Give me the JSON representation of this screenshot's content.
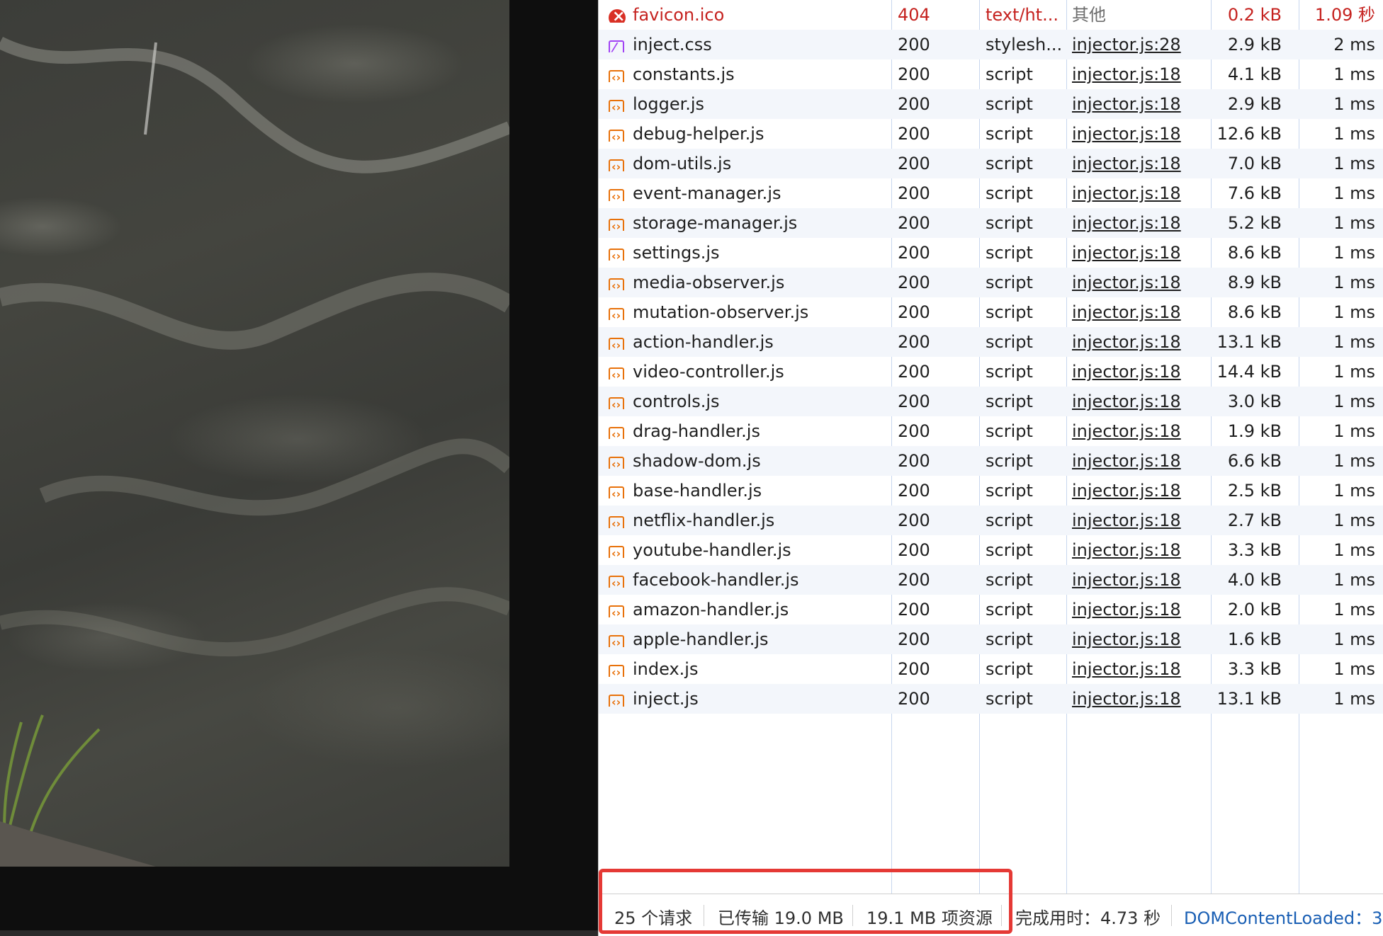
{
  "requests": [
    {
      "name": "favicon.ico",
      "status": "404",
      "type": "text/ht...",
      "initiator": "其他",
      "size": "0.2 kB",
      "time": "1.09 秒",
      "icon": "error-icon",
      "error": true
    },
    {
      "name": "inject.css",
      "status": "200",
      "type": "stylesh...",
      "initiator": "injector.js:28",
      "size": "2.9 kB",
      "time": "2 ms",
      "icon": "stylesheet-icon"
    },
    {
      "name": "constants.js",
      "status": "200",
      "type": "script",
      "initiator": "injector.js:18",
      "size": "4.1 kB",
      "time": "1 ms",
      "icon": "script-icon"
    },
    {
      "name": "logger.js",
      "status": "200",
      "type": "script",
      "initiator": "injector.js:18",
      "size": "2.9 kB",
      "time": "1 ms",
      "icon": "script-icon"
    },
    {
      "name": "debug-helper.js",
      "status": "200",
      "type": "script",
      "initiator": "injector.js:18",
      "size": "12.6 kB",
      "time": "1 ms",
      "icon": "script-icon"
    },
    {
      "name": "dom-utils.js",
      "status": "200",
      "type": "script",
      "initiator": "injector.js:18",
      "size": "7.0 kB",
      "time": "1 ms",
      "icon": "script-icon"
    },
    {
      "name": "event-manager.js",
      "status": "200",
      "type": "script",
      "initiator": "injector.js:18",
      "size": "7.6 kB",
      "time": "1 ms",
      "icon": "script-icon"
    },
    {
      "name": "storage-manager.js",
      "status": "200",
      "type": "script",
      "initiator": "injector.js:18",
      "size": "5.2 kB",
      "time": "1 ms",
      "icon": "script-icon"
    },
    {
      "name": "settings.js",
      "status": "200",
      "type": "script",
      "initiator": "injector.js:18",
      "size": "8.6 kB",
      "time": "1 ms",
      "icon": "script-icon"
    },
    {
      "name": "media-observer.js",
      "status": "200",
      "type": "script",
      "initiator": "injector.js:18",
      "size": "8.9 kB",
      "time": "1 ms",
      "icon": "script-icon"
    },
    {
      "name": "mutation-observer.js",
      "status": "200",
      "type": "script",
      "initiator": "injector.js:18",
      "size": "8.6 kB",
      "time": "1 ms",
      "icon": "script-icon"
    },
    {
      "name": "action-handler.js",
      "status": "200",
      "type": "script",
      "initiator": "injector.js:18",
      "size": "13.1 kB",
      "time": "1 ms",
      "icon": "script-icon"
    },
    {
      "name": "video-controller.js",
      "status": "200",
      "type": "script",
      "initiator": "injector.js:18",
      "size": "14.4 kB",
      "time": "1 ms",
      "icon": "script-icon"
    },
    {
      "name": "controls.js",
      "status": "200",
      "type": "script",
      "initiator": "injector.js:18",
      "size": "3.0 kB",
      "time": "1 ms",
      "icon": "script-icon"
    },
    {
      "name": "drag-handler.js",
      "status": "200",
      "type": "script",
      "initiator": "injector.js:18",
      "size": "1.9 kB",
      "time": "1 ms",
      "icon": "script-icon"
    },
    {
      "name": "shadow-dom.js",
      "status": "200",
      "type": "script",
      "initiator": "injector.js:18",
      "size": "6.6 kB",
      "time": "1 ms",
      "icon": "script-icon"
    },
    {
      "name": "base-handler.js",
      "status": "200",
      "type": "script",
      "initiator": "injector.js:18",
      "size": "2.5 kB",
      "time": "1 ms",
      "icon": "script-icon"
    },
    {
      "name": "netflix-handler.js",
      "status": "200",
      "type": "script",
      "initiator": "injector.js:18",
      "size": "2.7 kB",
      "time": "1 ms",
      "icon": "script-icon"
    },
    {
      "name": "youtube-handler.js",
      "status": "200",
      "type": "script",
      "initiator": "injector.js:18",
      "size": "3.3 kB",
      "time": "1 ms",
      "icon": "script-icon"
    },
    {
      "name": "facebook-handler.js",
      "status": "200",
      "type": "script",
      "initiator": "injector.js:18",
      "size": "4.0 kB",
      "time": "1 ms",
      "icon": "script-icon"
    },
    {
      "name": "amazon-handler.js",
      "status": "200",
      "type": "script",
      "initiator": "injector.js:18",
      "size": "2.0 kB",
      "time": "1 ms",
      "icon": "script-icon"
    },
    {
      "name": "apple-handler.js",
      "status": "200",
      "type": "script",
      "initiator": "injector.js:18",
      "size": "1.6 kB",
      "time": "1 ms",
      "icon": "script-icon"
    },
    {
      "name": "index.js",
      "status": "200",
      "type": "script",
      "initiator": "injector.js:18",
      "size": "3.3 kB",
      "time": "1 ms",
      "icon": "script-icon"
    },
    {
      "name": "inject.js",
      "status": "200",
      "type": "script",
      "initiator": "injector.js:18",
      "size": "13.1 kB",
      "time": "1 ms",
      "icon": "script-icon"
    }
  ],
  "status_bar": {
    "requests": "25 个请求",
    "transferred": "已传输 19.0 MB",
    "resources": "19.1 MB 项资源",
    "finish": "完成用时：4.73 秒",
    "dom_content_loaded": "DOMContentLoaded：3."
  },
  "colors": {
    "error": "#c5221f",
    "highlight": "#e53935",
    "link": "#1a5fb4"
  }
}
